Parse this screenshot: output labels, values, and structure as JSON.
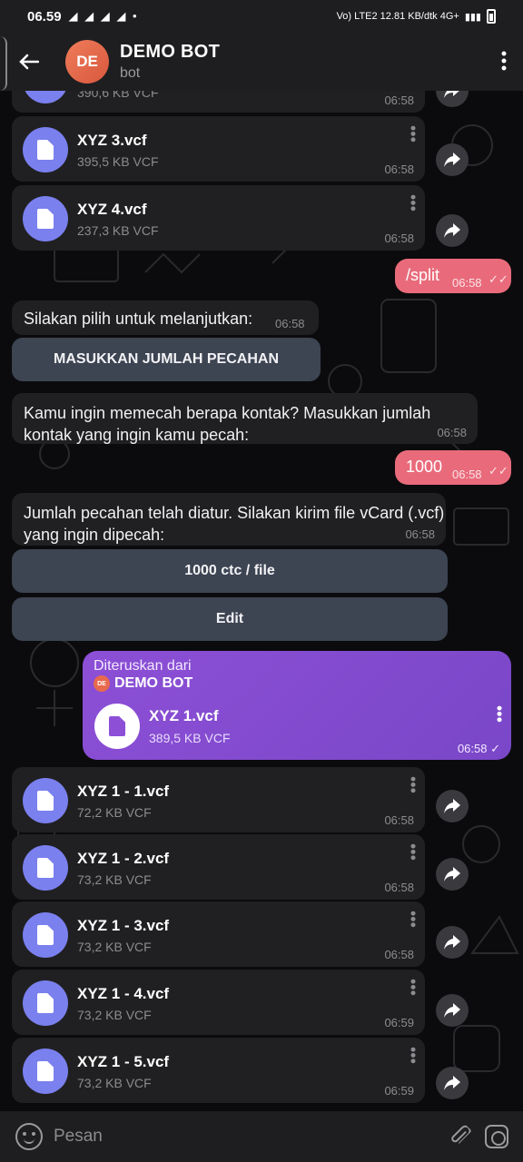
{
  "status": {
    "time": "06.59",
    "notif_icons": "◢ ◢ ◢ ◢ •",
    "right_info": "Vo) LTE2 12.81 KB/dtk 4G+"
  },
  "header": {
    "back_icon": "arrow-left-icon",
    "avatar_initials": "DE",
    "title": "DEMO BOT",
    "subtitle": "bot",
    "menu_icon": "more-vert-icon"
  },
  "files_top": [
    {
      "name": "",
      "size": "390,6 KB VCF",
      "time": "06:58"
    },
    {
      "name": "XYZ 3.vcf",
      "size": "395,5 KB VCF",
      "time": "06:58"
    },
    {
      "name": "XYZ 4.vcf",
      "size": "237,3 KB VCF",
      "time": "06:58"
    }
  ],
  "out_split": {
    "text": "/split",
    "time": "06:58"
  },
  "in_choose": {
    "text": "Silakan pilih untuk melanjutkan:",
    "time": "06:58"
  },
  "btn_jumlah": "MASUKKAN JUMLAH PECAHAN",
  "in_ask": {
    "text": "Kamu ingin memecah berapa kontak? Masukkan jumlah kontak yang ingin kamu pecah:",
    "time": "06:58"
  },
  "out_1000": {
    "text": "1000",
    "time": "06:58"
  },
  "in_set": {
    "text": "Jumlah pecahan telah diatur. Silakan kirim file vCard (.vcf) yang ingin dipecah:",
    "time": "06:58"
  },
  "btn_ctc": "1000 ctc / file",
  "btn_edit": "Edit",
  "forward": {
    "label": "Diteruskan dari",
    "source_initials": "DE",
    "source": "DEMO BOT",
    "name": "XYZ 1.vcf",
    "size": "389,5 KB VCF",
    "time": "06:58"
  },
  "files_bottom": [
    {
      "name": "XYZ 1 - 1.vcf",
      "size": "72,2 KB VCF",
      "time": "06:58"
    },
    {
      "name": "XYZ 1 - 2.vcf",
      "size": "73,2 KB VCF",
      "time": "06:58"
    },
    {
      "name": "XYZ 1 - 3.vcf",
      "size": "73,2 KB VCF",
      "time": "06:58"
    },
    {
      "name": "XYZ 1 - 4.vcf",
      "size": "73,2 KB VCF",
      "time": "06:59"
    },
    {
      "name": "XYZ 1 - 5.vcf",
      "size": "73,2 KB VCF",
      "time": "06:59"
    }
  ],
  "input": {
    "placeholder": "Pesan"
  },
  "colors": {
    "accent_out": "#e96b7b",
    "forward_bubble": "#8c4fd6",
    "file_icon": "#7a80ee",
    "bubble_in": "#202022"
  }
}
